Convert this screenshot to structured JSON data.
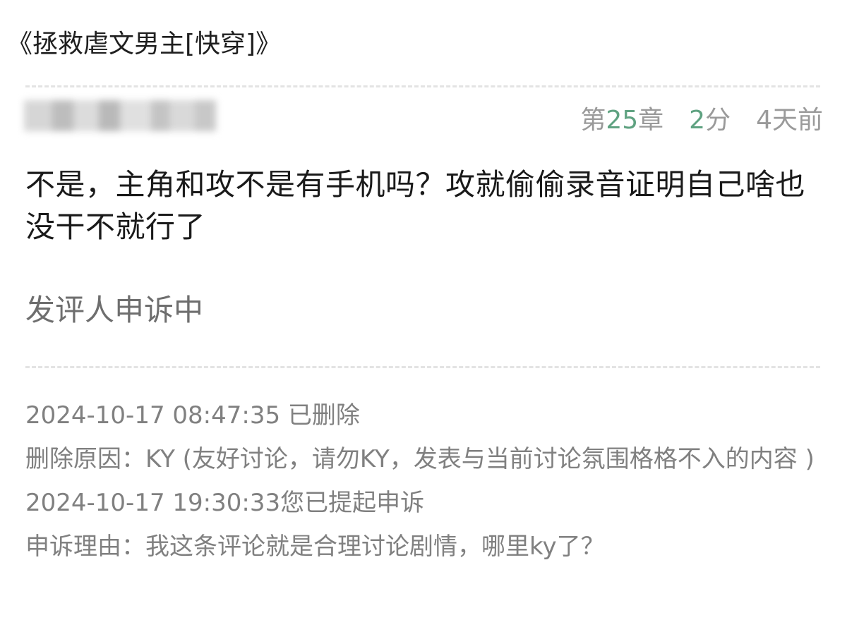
{
  "book_title": "《拯救虐文男主[快穿]》",
  "comment": {
    "username_obscured": true,
    "chapter_prefix": "第",
    "chapter_number": "25",
    "chapter_suffix": "章",
    "score_value": "2",
    "score_unit": "分",
    "time_ago": "4天前",
    "body": "不是，主角和攻不是有手机吗？攻就偷偷录音证明自己啥也没干不就行了",
    "appeal_status": "发评人申诉中"
  },
  "moderation_log": {
    "deleted_at": "2024-10-17 08:47:35 已删除",
    "delete_reason": "删除原因：KY (友好讨论，请勿KY，发表与当前讨论氛围格格不入的内容 )",
    "appeal_at": "2024-10-17 19:30:33您已提起申诉",
    "appeal_reason": "申诉理由：我这条评论就是合理讨论剧情，哪里ky了？"
  },
  "colors": {
    "accent_green": "#5fa281",
    "meta_gray": "#9a9a9a",
    "log_gray": "#808080",
    "divider": "#e3e3e3"
  }
}
